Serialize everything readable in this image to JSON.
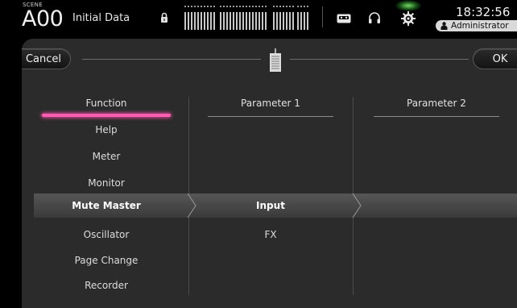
{
  "status": {
    "scene_label": "SCENE",
    "scene_number": "A00",
    "scene_title": "Initial Data",
    "time": "18:32:56",
    "user": "Administrator"
  },
  "header": {
    "cancel_label": "Cancel",
    "ok_label": "OK"
  },
  "columns": {
    "function": "Function",
    "param1": "Parameter 1",
    "param2": "Parameter 2"
  },
  "function_list": [
    "Help",
    "Meter",
    "Monitor",
    "Mute Master",
    "Oscillator",
    "Page Change",
    "Recorder"
  ],
  "selected_function": "Mute Master",
  "param1_list": [
    "Input",
    "FX"
  ],
  "selected_param1": "Input",
  "colors": {
    "accent_pink": "#ff5fb3",
    "gear_glow": "#8cff78"
  }
}
